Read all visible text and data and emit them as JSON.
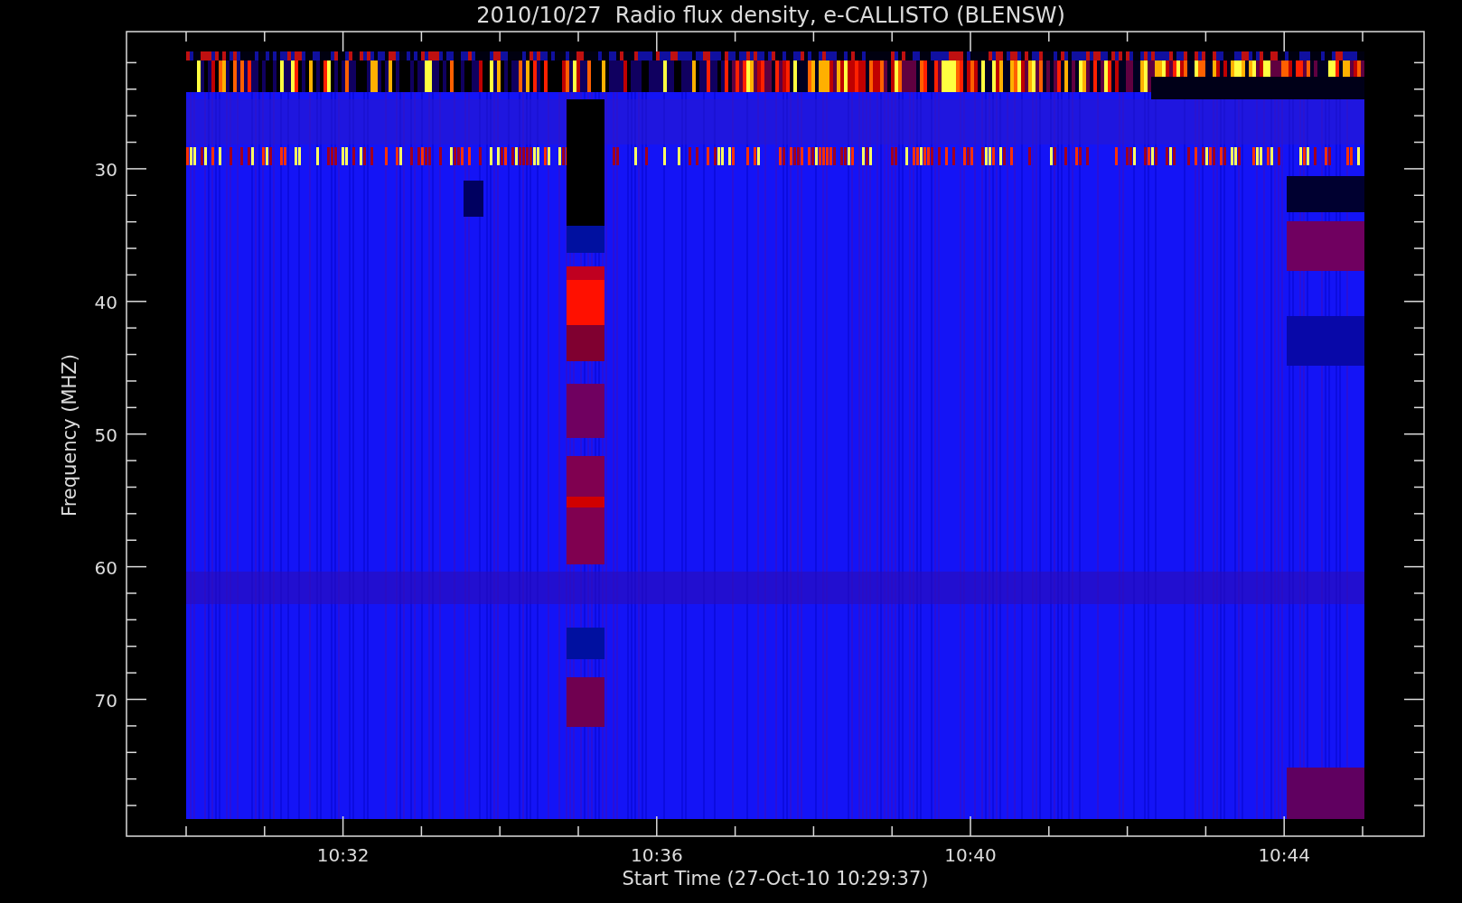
{
  "title": "2010/10/27  Radio flux density, e-CALLISTO (BLENSW)",
  "y_axis": {
    "title": "Frequency (MHZ)",
    "ticks": [
      "30",
      "40",
      "50",
      "60",
      "70"
    ]
  },
  "x_axis": {
    "title": "Start Time (27-Oct-10 10:29:37)",
    "ticks": [
      "10:32",
      "10:36",
      "10:40",
      "10:44"
    ]
  }
}
